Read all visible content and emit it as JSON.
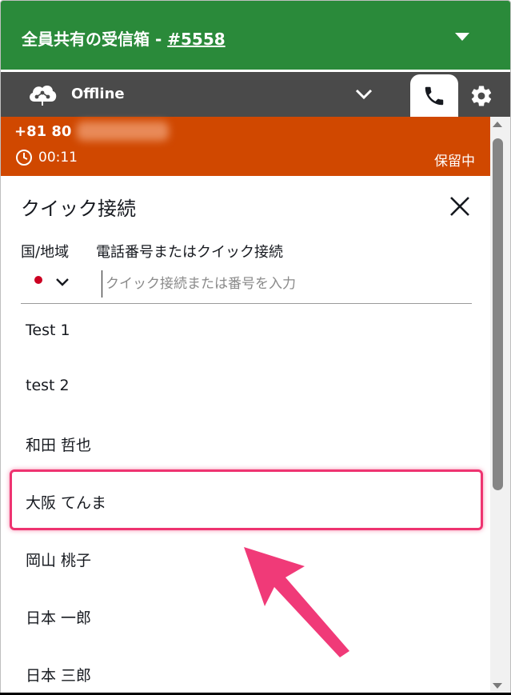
{
  "header": {
    "title": "全員共有の受信箱 - ",
    "number": "#5558"
  },
  "status": {
    "label": "Offline"
  },
  "call": {
    "number": "+81 80",
    "timer": "00:11",
    "state": "保留中"
  },
  "quick_connect": {
    "title": "クイック接続",
    "country_label": "国/地域",
    "phone_label": "電話番号またはクイック接続",
    "placeholder": "クイック接続または番号を入力",
    "contacts": [
      {
        "name": "Test 1"
      },
      {
        "name": "test 2"
      },
      {
        "name": "和田 哲也"
      },
      {
        "name": "大阪 てんま"
      },
      {
        "name": "岡山 桃子"
      },
      {
        "name": "日本 一郎"
      },
      {
        "name": "日本 三郎"
      }
    ]
  },
  "colors": {
    "header_green": "#2a8a3a",
    "status_gray": "#4a4a4a",
    "call_orange": "#d04800",
    "highlight_pink": "#ee3370"
  }
}
